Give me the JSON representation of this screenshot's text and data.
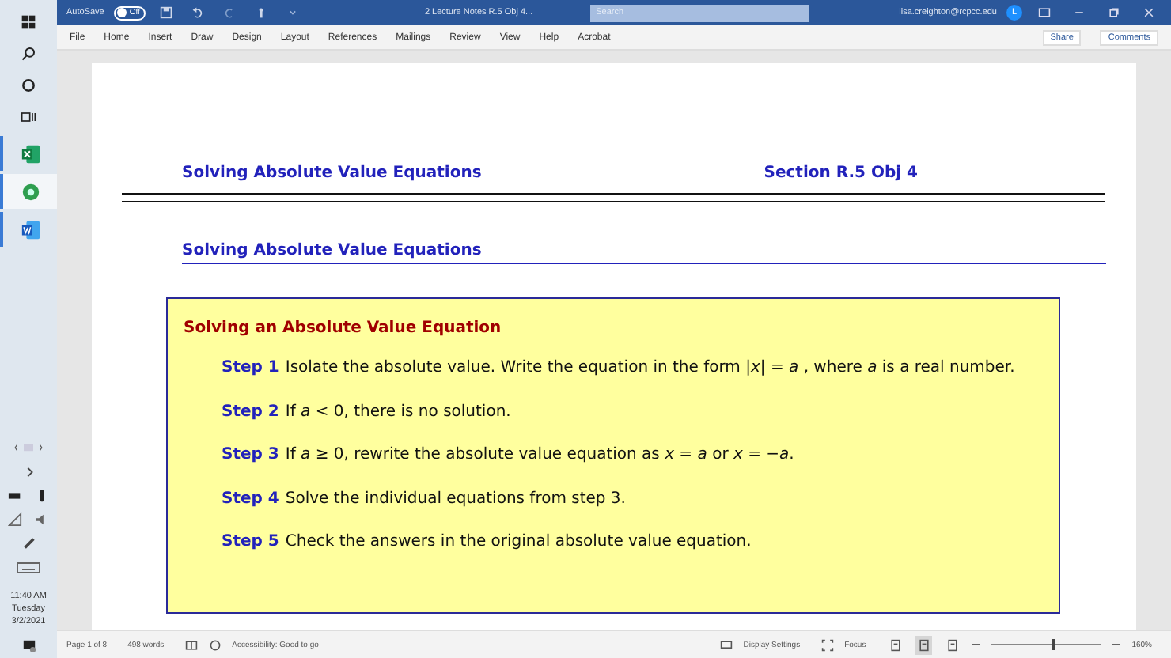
{
  "taskbar": {
    "time": "11:40 AM",
    "day": "Tuesday",
    "date": "3/2/2021",
    "apps": [
      {
        "kind": "excel",
        "selected": false
      },
      {
        "kind": "recycle",
        "selected": true
      },
      {
        "kind": "word",
        "selected": false
      }
    ]
  },
  "title_bar": {
    "autosave_label": "AutoSave",
    "autosave_state": "Off",
    "autosave_on": false,
    "document_title": "2 Lecture Notes R.5 Obj 4...",
    "search": {
      "placeholder": "Search"
    },
    "account": "lisa.creighton@rcpcc.edu",
    "avatar": "L"
  },
  "menu": {
    "items": [
      "File",
      "Home",
      "Insert",
      "Draw",
      "Design",
      "Layout",
      "References",
      "Mailings",
      "Review",
      "View",
      "Help",
      "Acrobat"
    ],
    "share": "Share",
    "comments": "Comments"
  },
  "document": {
    "header_left": "Solving Absolute Value Equations",
    "header_right": "Section R.5 Obj 4",
    "heading": "Solving Absolute Value Equations",
    "box": {
      "title": "Solving an Absolute Value Equation",
      "steps": [
        {
          "label": "Step 1",
          "text": "Isolate the absolute value. Write the equation in the form |*x*| = *a* , where *a* is a real number."
        },
        {
          "label": "Step 2",
          "text": "If *a* < 0, there is no solution."
        },
        {
          "label": "Step 3",
          "text": "If *a* ≥ 0, rewrite the absolute value equation as *x* = *a* or *x* = −*a*."
        },
        {
          "label": "Step 4",
          "text": "Solve the individual equations from step 3."
        },
        {
          "label": "Step 5",
          "text": "Check the answers in the original absolute value equation."
        }
      ]
    }
  },
  "status_bar": {
    "page": "Page 1 of 8",
    "words": "498 words",
    "accessibility": "Accessibility: Good to go",
    "display_settings": "Display Settings",
    "focus": "Focus",
    "views": [
      {
        "selected": false
      },
      {
        "selected": true
      },
      {
        "selected": false
      }
    ],
    "zoom": {
      "level": 0.55
    },
    "zoom_value": "160%"
  }
}
